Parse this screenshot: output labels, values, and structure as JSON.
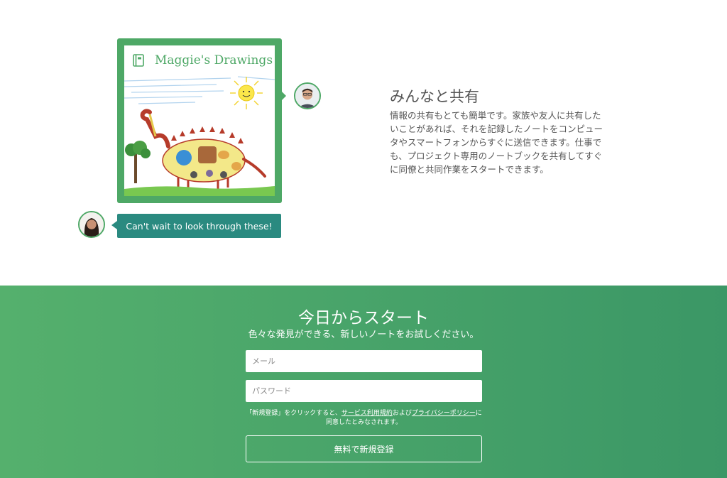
{
  "feature": {
    "notebook": {
      "title": "Maggie's Drawings",
      "icon": "notebook-icon"
    },
    "comment": "Can't wait to look through these!",
    "heading": "みんなと共有",
    "body": "情報の共有もとても簡単です。家族や友人に共有したいことがあれば、それを記録したノートをコンピュータやスマートフォンからすぐに送信できます。仕事でも、プロジェクト専用のノートブックを共有してすぐに同僚と共同作業をスタートできます。"
  },
  "signup": {
    "title": "今日からスタート",
    "subtitle": "色々な発見ができる、新しいノートをお試しください。",
    "email_placeholder": "メール",
    "password_placeholder": "パスワード",
    "terms_prefix": "「新規登録」をクリックすると、",
    "terms_link": "サービス利用規約",
    "terms_mid": "および",
    "privacy_link": "プライバシーポリシー",
    "terms_suffix": "に同意したとみなされます。",
    "button_label": "無料で新規登録"
  },
  "colors": {
    "brand_green": "#4ea866",
    "comment_teal": "#2a8a80",
    "signup_gradient_start": "#55b06d",
    "signup_gradient_end": "#3b9766"
  }
}
